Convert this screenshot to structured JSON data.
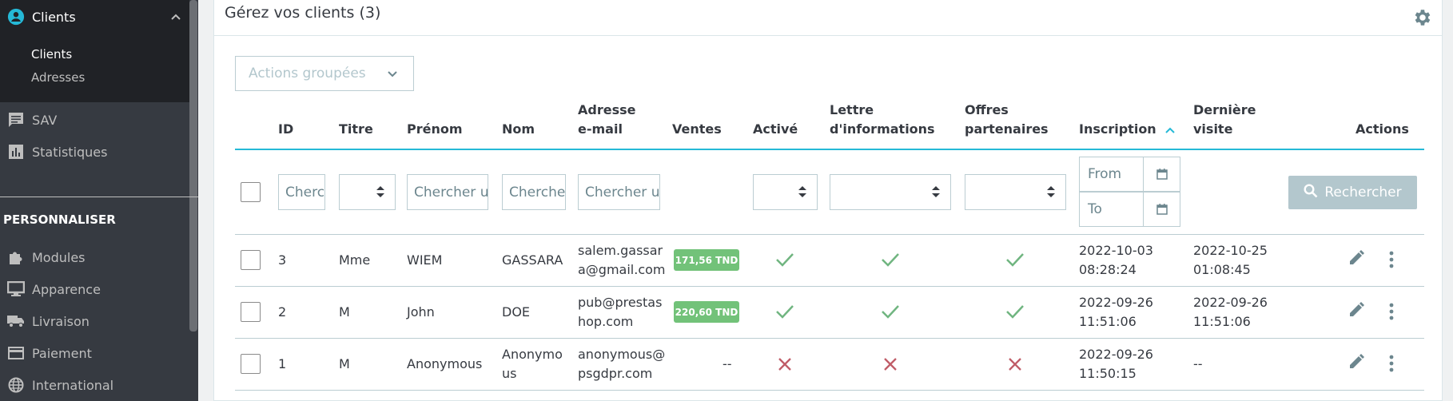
{
  "sidebar": {
    "clients_label": "Clients",
    "sub_clients": "Clients",
    "sub_addresses": "Adresses",
    "sav": "SAV",
    "stats": "Statistiques",
    "section": "PERSONNALISER",
    "modules": "Modules",
    "appearance": "Apparence",
    "delivery": "Livraison",
    "payment": "Paiement",
    "international": "International"
  },
  "panel": {
    "title": "Gérez vos clients (3)",
    "bulk_actions": "Actions groupées"
  },
  "columns": {
    "id": "ID",
    "title": "Titre",
    "firstname": "Prénom",
    "lastname": "Nom",
    "email_1": "Adresse",
    "email_2": "e-mail",
    "sales": "Ventes",
    "active": "Activé",
    "newsletter_1": "Lettre",
    "newsletter_2": "d'informations",
    "optin_1": "Offres",
    "optin_2": "partenaires",
    "registration": "Inscription",
    "last_visit_1": "Dernière",
    "last_visit_2": "visite",
    "actions": "Actions"
  },
  "filters": {
    "id_ph": "Chercher",
    "firstname_ph": "Chercher un prénom",
    "lastname_ph": "Chercher un nom",
    "email_ph": "Chercher un e-mail",
    "from_ph": "From",
    "to_ph": "To",
    "search_label": "Rechercher"
  },
  "rows": [
    {
      "id": "3",
      "title": "Mme",
      "firstname": "WIEM",
      "lastname_1": "GASSARA",
      "lastname_2": "",
      "email_1": "salem.gassar",
      "email_2": "a@gmail.com",
      "sales": "171,56 TND",
      "active": true,
      "newsletter": true,
      "optin": true,
      "reg_1": "2022-10-03",
      "reg_2": "08:28:24",
      "visit_1": "2022-10-25",
      "visit_2": "01:08:45"
    },
    {
      "id": "2",
      "title": "M",
      "firstname": "John",
      "lastname_1": "DOE",
      "lastname_2": "",
      "email_1": "pub@prestas",
      "email_2": "hop.com",
      "sales": "220,60 TND",
      "active": true,
      "newsletter": true,
      "optin": true,
      "reg_1": "2022-09-26",
      "reg_2": "11:51:06",
      "visit_1": "2022-09-26",
      "visit_2": "11:51:06"
    },
    {
      "id": "1",
      "title": "M",
      "firstname": "Anonymous",
      "lastname_1": "Anonymo",
      "lastname_2": "us",
      "email_1": "anonymous@",
      "email_2": "psgdpr.com",
      "sales": "--",
      "active": false,
      "newsletter": false,
      "optin": false,
      "reg_1": "2022-09-26",
      "reg_2": "11:50:15",
      "visit_1": "--",
      "visit_2": ""
    }
  ],
  "colors": {
    "accent": "#25b9d7",
    "success": "#70b580",
    "danger": "#c05c67",
    "badge": "#72c279",
    "sidebar_bg": "#363a41"
  }
}
